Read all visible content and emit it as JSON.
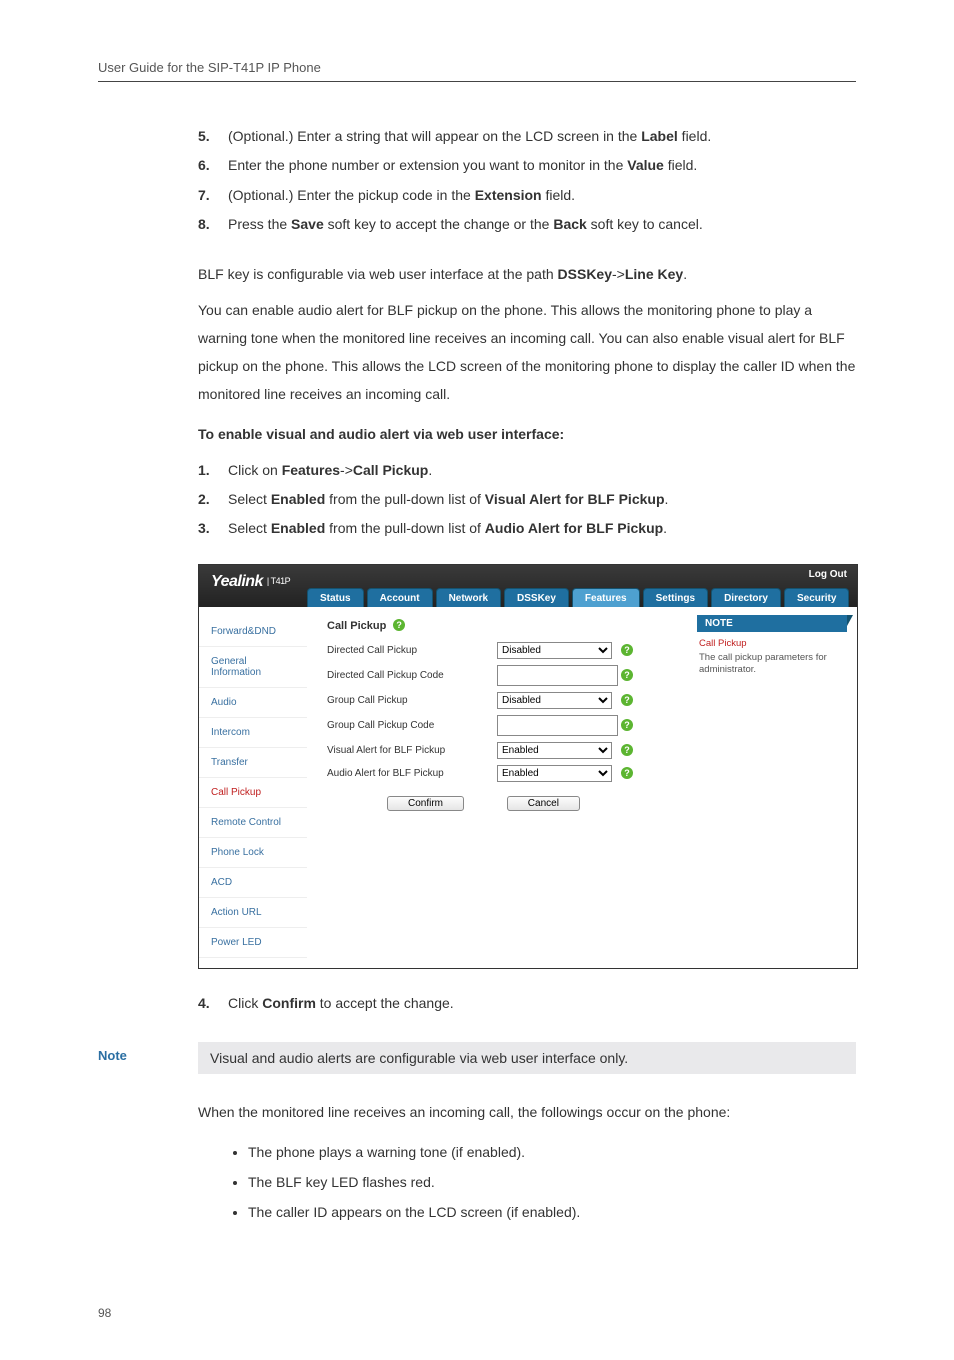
{
  "header": "User Guide for the SIP-T41P IP Phone",
  "steps_first": [
    {
      "n": "5.",
      "pre": "(Optional.) Enter a string that will appear on the LCD screen in the ",
      "b": "Label",
      "post": " field."
    },
    {
      "n": "6.",
      "pre": "Enter the phone number or extension you want to monitor in the ",
      "b": "Value",
      "post": " field."
    },
    {
      "n": "7.",
      "pre": "(Optional.) Enter the pickup code in the ",
      "b": "Extension",
      "post": " field."
    },
    {
      "n": "8.",
      "pre": "Press the ",
      "b": "Save",
      "mid": " soft key to accept the change or the ",
      "b2": "Back",
      "post": " soft key to cancel."
    }
  ],
  "p1_pre": "BLF key is configurable via web user interface at the path ",
  "p1_b1": "DSSKey",
  "p1_mid": "->",
  "p1_b2": "Line Key",
  "p1_post": ".",
  "p2": "You can enable audio alert for BLF pickup on the phone. This allows the monitoring phone to play a warning tone when the monitored line receives an incoming call. You can also enable visual alert for BLF pickup on the phone. This allows the LCD screen of the monitoring phone to display the caller ID when the monitored line receives an incoming call.",
  "sec_title": "To enable visual and audio alert via web user interface:",
  "steps_second": [
    {
      "n": "1.",
      "pre": "Click on ",
      "b": "Features",
      "mid": "->",
      "b2": "Call Pickup",
      "post": "."
    },
    {
      "n": "2.",
      "pre": "Select ",
      "b": "Enabled",
      "mid": " from the pull-down list of ",
      "b2": "Visual Alert for BLF Pickup",
      "post": "."
    },
    {
      "n": "3.",
      "pre": "Select ",
      "b": "Enabled",
      "mid": " from the pull-down list of ",
      "b2": "Audio Alert for BLF Pickup",
      "post": "."
    }
  ],
  "screenshot": {
    "logo": "Yealink",
    "logo_sub": "| T41P",
    "logout": "Log Out",
    "tabs": [
      "Status",
      "Account",
      "Network",
      "DSSKey",
      "Features",
      "Settings",
      "Directory",
      "Security"
    ],
    "active_tab": "Features",
    "sidebar": [
      "Forward&DND",
      "General Information",
      "Audio",
      "Intercom",
      "Transfer",
      "Call Pickup",
      "Remote Control",
      "Phone Lock",
      "ACD",
      "Action URL",
      "Power LED"
    ],
    "active_side": "Call Pickup",
    "section_title": "Call Pickup",
    "rows": [
      {
        "label": "Directed Call Pickup",
        "type": "select",
        "value": "Disabled"
      },
      {
        "label": "Directed Call Pickup Code",
        "type": "text",
        "value": ""
      },
      {
        "label": "Group Call Pickup",
        "type": "select",
        "value": "Disabled"
      },
      {
        "label": "Group Call Pickup Code",
        "type": "text",
        "value": ""
      },
      {
        "label": "Visual Alert for BLF Pickup",
        "type": "select",
        "value": "Enabled"
      },
      {
        "label": "Audio Alert for BLF Pickup",
        "type": "select",
        "value": "Enabled"
      }
    ],
    "confirm": "Confirm",
    "cancel": "Cancel",
    "note_head": "NOTE",
    "note_t": "Call Pickup",
    "note_body": "The call pickup parameters for administrator."
  },
  "step4": {
    "n": "4.",
    "pre": "Click ",
    "b": "Confirm",
    "post": " to accept the change."
  },
  "callout_label": "Note",
  "callout_text": "Visual and audio alerts are configurable via web user interface only.",
  "p3": "When the monitored line receives an incoming call, the followings occur on the phone:",
  "bullets": [
    "The phone plays a warning tone (if enabled).",
    "The BLF key LED flashes red.",
    "The caller ID appears on the LCD screen (if enabled)."
  ],
  "page_no": "98"
}
